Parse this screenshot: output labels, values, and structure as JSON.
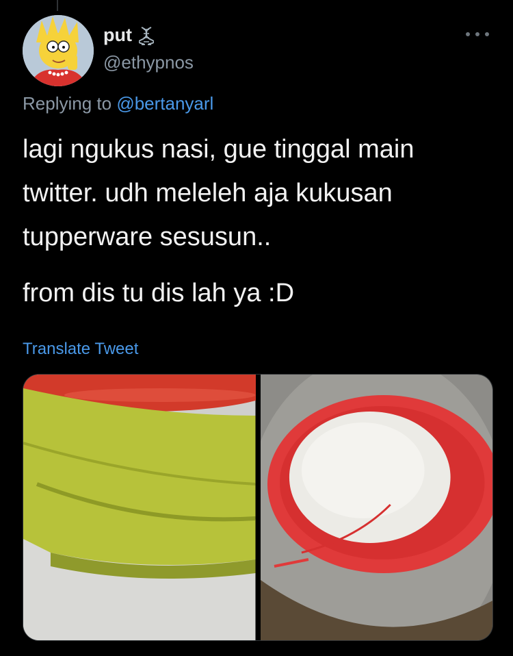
{
  "tweet": {
    "display_name": "put",
    "handle": "@ethypnos",
    "replying_prefix": "Replying to",
    "replying_to": "@bertanyarl",
    "text_lines": [
      "lagi ngukus nasi, gue tinggal main",
      "twitter. udh meleleh aja kukusan",
      "tupperware sesusun.."
    ],
    "text_line_2": "from dis tu dis lah ya :D",
    "translate_label": "Translate Tweet"
  },
  "colors": {
    "background": "#000000",
    "link": "#4a99e9",
    "muted": "#8b98a5",
    "text": "#e7e9ea"
  },
  "icons": {
    "author_badge": "dna-icon",
    "menu": "more-horizontal-icon"
  }
}
